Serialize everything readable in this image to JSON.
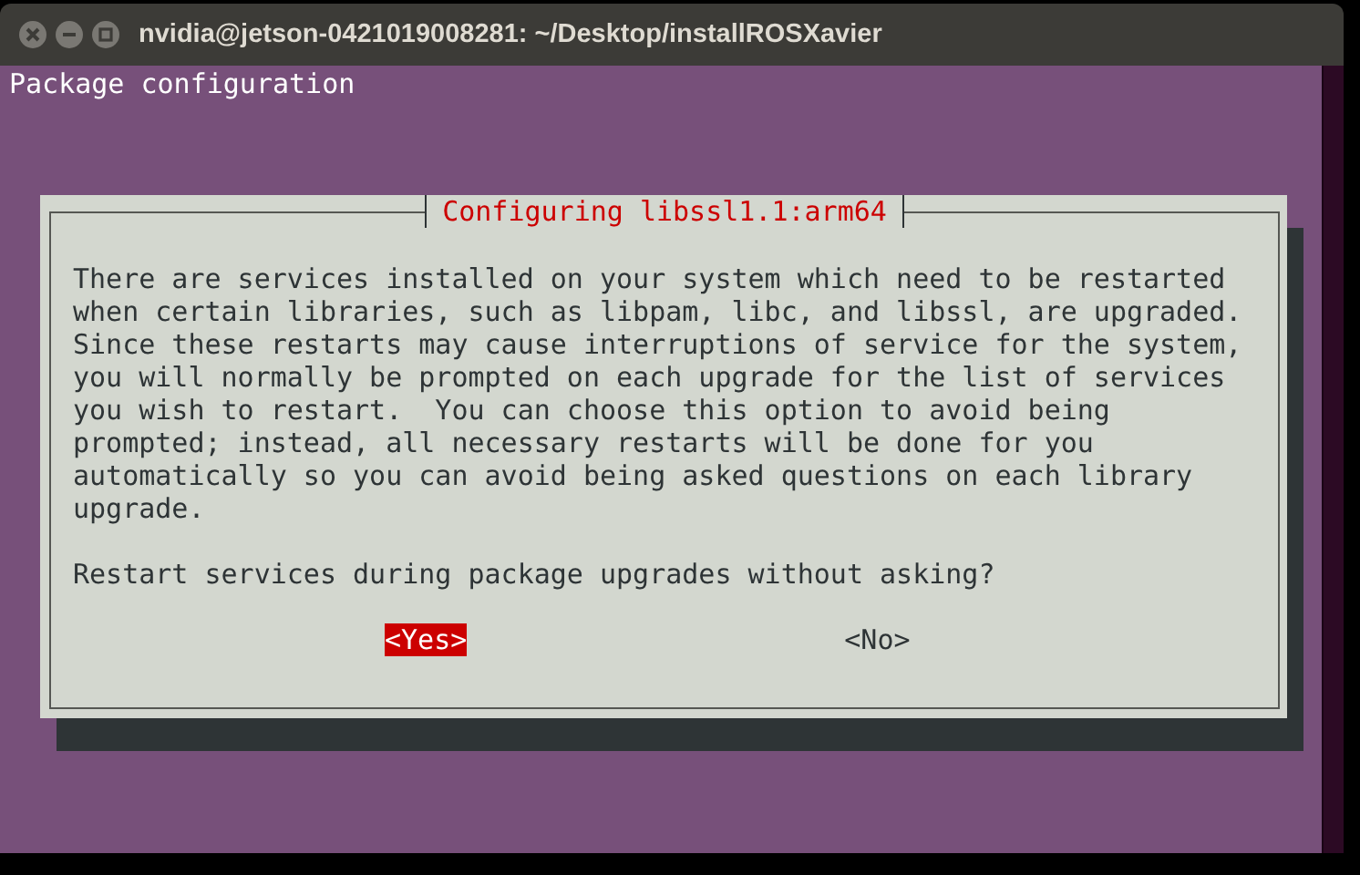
{
  "window": {
    "title": "nvidia@jetson-0421019008281: ~/Desktop/installROSXavier"
  },
  "terminal": {
    "header": "Package configuration"
  },
  "dialog": {
    "title": "Configuring libssl1.1:arm64",
    "message": "There are services installed on your system which need to be restarted\nwhen certain libraries, such as libpam, libc, and libssl, are upgraded.\nSince these restarts may cause interruptions of service for the system,\nyou will normally be prompted on each upgrade for the list of services\nyou wish to restart.  You can choose this option to avoid being\nprompted; instead, all necessary restarts will be done for you\nautomatically so you can avoid being asked questions on each library\nupgrade.",
    "question": "Restart services during package upgrades without asking?",
    "buttons": [
      {
        "label": "<Yes>",
        "selected": true
      },
      {
        "label": "<No>",
        "selected": false
      }
    ]
  }
}
